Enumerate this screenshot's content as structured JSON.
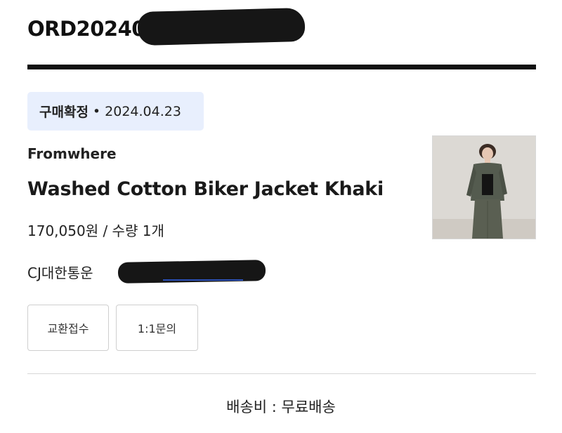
{
  "order": {
    "id_visible": "ORD202404"
  },
  "status": {
    "label": "구매확정",
    "separator": "•",
    "date": "2024.04.23"
  },
  "product": {
    "brand": "Fromwhere",
    "name": "Washed Cotton Biker Jacket Khaki",
    "price_line": "170,050원 / 수량 1개",
    "thumbnail_alt": "product-photo"
  },
  "delivery": {
    "courier": "CJ대한통운"
  },
  "actions": {
    "exchange_label": "교환접수",
    "inquiry_label": "1:1문의"
  },
  "shipping": {
    "fee_text": "배송비 : 무료배송"
  },
  "colors": {
    "badge_bg": "#e8effd",
    "link_blue": "#2a50b8",
    "text": "#1a1a1a"
  }
}
